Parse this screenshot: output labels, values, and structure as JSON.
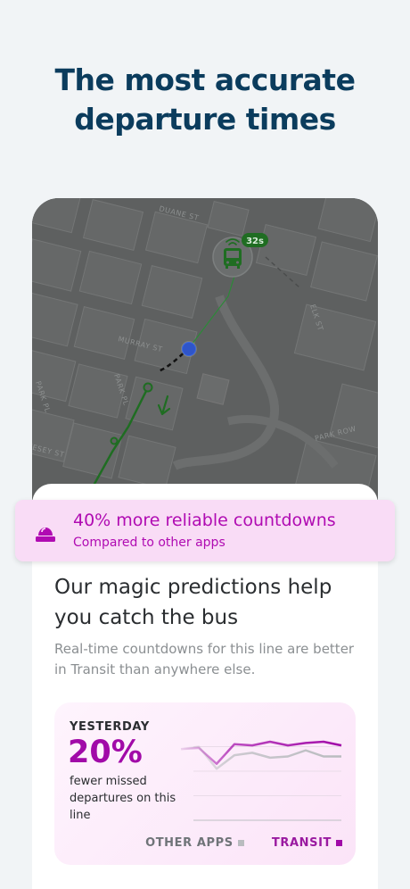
{
  "headline": {
    "line1": "The most accurate",
    "line2": "departure times"
  },
  "map": {
    "streets": [
      "DUANE ST",
      "MURRAY ST",
      "PARK PL",
      "VESEY ST",
      "PARK ROW",
      "ELK ST"
    ],
    "vehicle_badge": "32s",
    "icons": [
      "bus-icon",
      "realtime-signal-icon",
      "user-location-icon",
      "direction-arrow-icon"
    ]
  },
  "banner": {
    "title": "40% more reliable countdowns",
    "subtitle": "Compared to other apps",
    "icon": "alarm-light-icon",
    "color": "#b00bb2"
  },
  "sheet": {
    "title": "Our magic predictions help you catch the bus",
    "body": "Real-time countdowns for this line are better in Transit than anywhere else."
  },
  "stat_card": {
    "label": "YESTERDAY",
    "value": "20%",
    "description": "fewer missed departures on this line"
  },
  "chart_data": {
    "type": "line",
    "series": [
      {
        "name": "OTHER APPS",
        "color": "#b9bcbf",
        "values": [
          58,
          60,
          42,
          53,
          55,
          51,
          52,
          57,
          52,
          52
        ]
      },
      {
        "name": "TRANSIT",
        "color": "#a10aa8",
        "values": [
          58,
          59,
          46,
          62,
          61,
          64,
          61,
          63,
          64,
          61
        ]
      }
    ],
    "ylim": [
      0,
      80
    ],
    "grid": true
  },
  "legend": {
    "other": "OTHER APPS",
    "transit": "TRANSIT"
  },
  "colors": {
    "brand_navy": "#0b3c5d",
    "transit_magenta": "#a10aa8",
    "route_green": "#1f6d22"
  }
}
